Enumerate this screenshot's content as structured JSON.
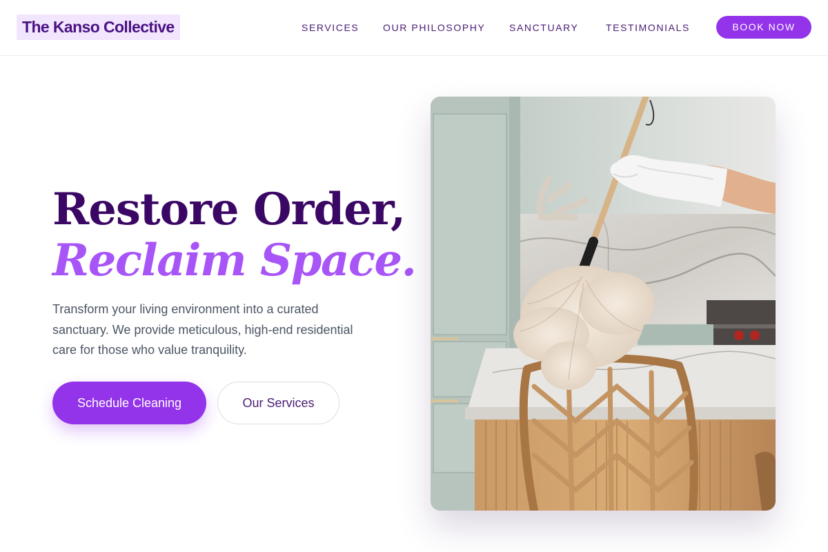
{
  "header": {
    "logo": "The Kanso Collective",
    "nav": [
      {
        "label": "SERVICES"
      },
      {
        "label": "OUR PHILOSOPHY"
      },
      {
        "label": "SANCTUARY"
      },
      {
        "label": "TESTIMONIALS"
      }
    ],
    "cta": "BOOK NOW"
  },
  "hero": {
    "title_line1": "Restore Order,",
    "title_line2": "Reclaim Space.",
    "description": "Transform your living environment into a curated sanctuary. We provide meticulous, high-end residential care for those who value tranquility.",
    "primary_button": "Schedule Cleaning",
    "secondary_button": "Our Services"
  },
  "colors": {
    "accent": "#9333ea",
    "accent_light": "#a855f7",
    "heading": "#3b0764",
    "logo_bg": "#f1e6fd"
  }
}
